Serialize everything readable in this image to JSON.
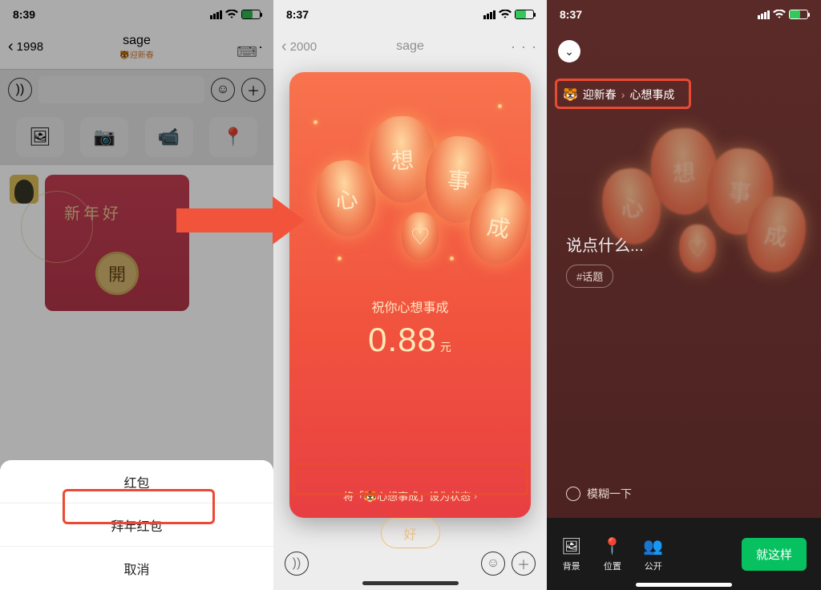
{
  "colors": {
    "accent_red": "#ea4a33",
    "envelope": "#d8445b",
    "gold": "#eac87a",
    "green_btn": "#07c160",
    "battery": "#34c759"
  },
  "screen1": {
    "time": "8:39",
    "back_count": "1998",
    "chat_name": "sage",
    "subtitle": "迎新春",
    "envelope_text": "新年好",
    "envelope_button": "開",
    "sheet": {
      "hongbao": "红包",
      "ny_hongbao": "拜年红包",
      "cancel": "取消"
    }
  },
  "screen2": {
    "time": "8:37",
    "back_count": "2000",
    "chat_name": "sage",
    "lantern_chars": [
      "心",
      "想",
      "事",
      "成",
      "♡"
    ],
    "wish": "祝你心想事成",
    "amount": "0.88",
    "currency": "元",
    "set_status": "将「🐯心想事成」设为状态",
    "ok": "好"
  },
  "screen3": {
    "time": "8:37",
    "crumbs": {
      "emoji": "🐯",
      "a": "迎新春",
      "b": "心想事成"
    },
    "lantern_chars": [
      "心",
      "想",
      "事",
      "成",
      "♡"
    ],
    "say_placeholder": "说点什么...",
    "topic_chip": "#话题",
    "blur_option": "模糊一下",
    "bottom": {
      "bg": "背景",
      "loc": "位置",
      "vis": "公开",
      "confirm": "就这样"
    }
  }
}
